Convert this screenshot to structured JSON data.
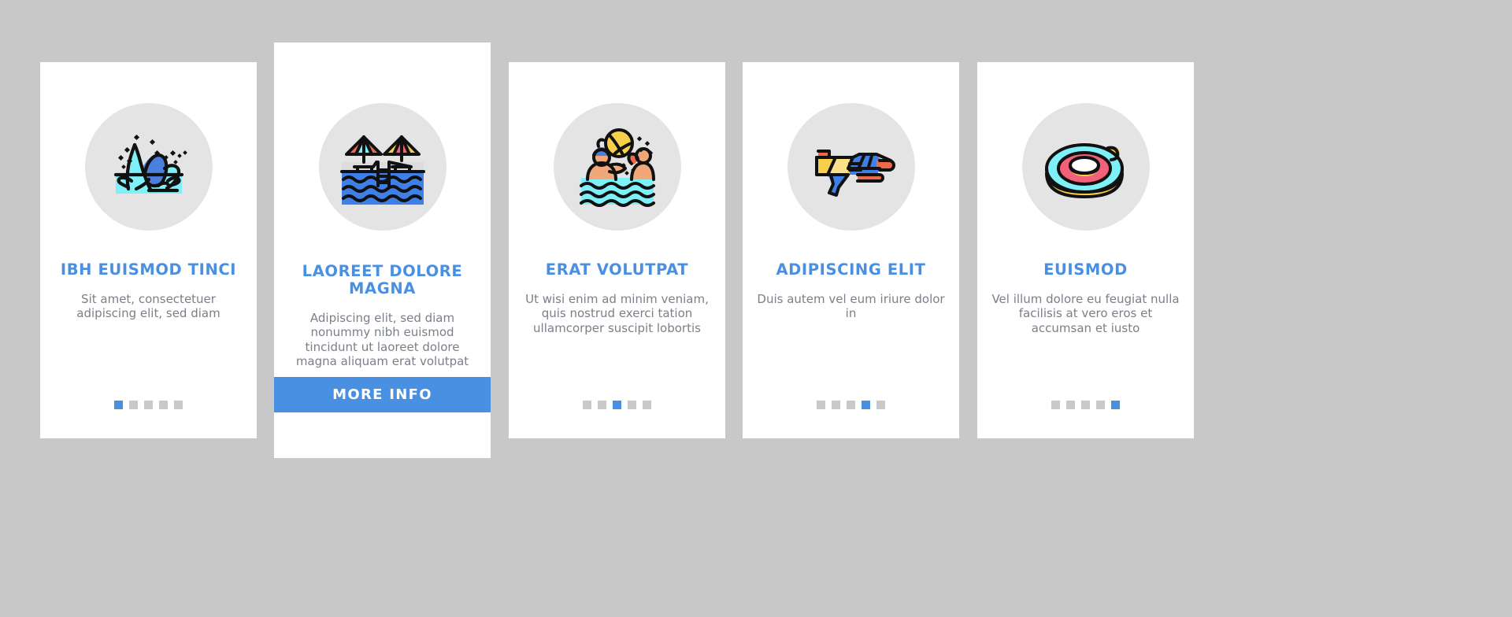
{
  "page": {
    "background_color": "#c8c8c8",
    "card_background": "#ffffff",
    "accent_color": "#4a90e2",
    "icon_circle_color": "#e4e4e4",
    "title_color": "#4a90e2",
    "body_color": "#7a7f88",
    "dot_inactive_color": "#c9c9c9"
  },
  "cards": [
    {
      "icon": "water-splash-icon",
      "title": "IBH EUISMOD TINCI",
      "body": "Sit amet, consectetuer adipiscing elit, sed diam",
      "dots": {
        "count": 5,
        "active_index": 0
      },
      "featured": false,
      "button": null
    },
    {
      "icon": "swimming-pool-umbrellas-icon",
      "title": "LAOREET DOLORE MAGNA",
      "body": "Adipiscing elit, sed diam nonummy nibh euismod tincidunt ut laoreet dolore magna aliquam erat volutpat",
      "dots": null,
      "featured": true,
      "button": {
        "label": "MORE INFO",
        "color": "#4a90e2"
      }
    },
    {
      "icon": "water-polo-players-icon",
      "title": "ERAT VOLUTPAT",
      "body": "Ut wisi enim ad minim veniam, quis nostrud exerci tation ullamcorper suscipit lobortis",
      "dots": {
        "count": 5,
        "active_index": 2
      },
      "featured": false,
      "button": null
    },
    {
      "icon": "water-gun-icon",
      "title": "ADIPISCING ELIT",
      "body": "Duis autem vel eum iriure dolor in",
      "dots": {
        "count": 5,
        "active_index": 3
      },
      "featured": false,
      "button": null
    },
    {
      "icon": "swim-ring-icon",
      "title": "EUISMOD",
      "body": "Vel illum dolore eu feugiat nulla facilisis at vero eros et accumsan et iusto",
      "dots": {
        "count": 5,
        "active_index": 4
      },
      "featured": false,
      "button": null
    }
  ]
}
